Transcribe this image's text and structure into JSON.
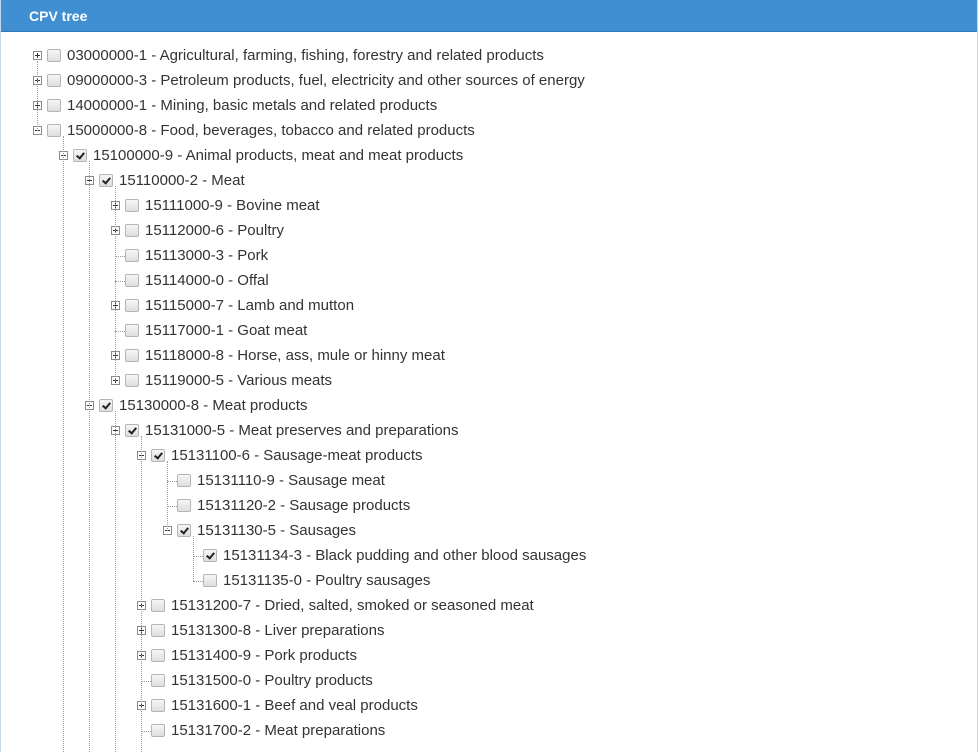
{
  "panel": {
    "title": "CPV tree"
  },
  "tree": [
    {
      "depth": 0,
      "toggle": "plus",
      "checked": false,
      "label": "03000000-1 - Agricultural, farming, fishing, forestry and related products"
    },
    {
      "depth": 0,
      "toggle": "plus",
      "checked": false,
      "label": "09000000-3 - Petroleum products, fuel, electricity and other sources of energy"
    },
    {
      "depth": 0,
      "toggle": "plus",
      "checked": false,
      "label": "14000000-1 - Mining, basic metals and related products"
    },
    {
      "depth": 0,
      "toggle": "minus",
      "checked": false,
      "label": "15000000-8 - Food, beverages, tobacco and related products"
    },
    {
      "depth": 1,
      "toggle": "minus",
      "checked": true,
      "label": "15100000-9 - Animal products, meat and meat products"
    },
    {
      "depth": 2,
      "toggle": "minus",
      "checked": true,
      "label": "15110000-2 - Meat"
    },
    {
      "depth": 3,
      "toggle": "plus",
      "checked": false,
      "label": "15111000-9 - Bovine meat"
    },
    {
      "depth": 3,
      "toggle": "plus",
      "checked": false,
      "label": "15112000-6 - Poultry"
    },
    {
      "depth": 3,
      "toggle": "none",
      "checked": false,
      "label": "15113000-3 - Pork"
    },
    {
      "depth": 3,
      "toggle": "none",
      "checked": false,
      "label": "15114000-0 - Offal"
    },
    {
      "depth": 3,
      "toggle": "plus",
      "checked": false,
      "label": "15115000-7 - Lamb and mutton"
    },
    {
      "depth": 3,
      "toggle": "none",
      "checked": false,
      "label": "15117000-1 - Goat meat"
    },
    {
      "depth": 3,
      "toggle": "plus",
      "checked": false,
      "label": "15118000-8 - Horse, ass, mule or hinny meat"
    },
    {
      "depth": 3,
      "toggle": "plus",
      "checked": false,
      "label": "15119000-5 - Various meats"
    },
    {
      "depth": 2,
      "toggle": "minus",
      "checked": true,
      "label": "15130000-8 - Meat products"
    },
    {
      "depth": 3,
      "toggle": "minus",
      "checked": true,
      "label": "15131000-5 - Meat preserves and preparations"
    },
    {
      "depth": 4,
      "toggle": "minus",
      "checked": true,
      "label": "15131100-6 - Sausage-meat products"
    },
    {
      "depth": 5,
      "toggle": "none",
      "checked": false,
      "label": "15131110-9 - Sausage meat"
    },
    {
      "depth": 5,
      "toggle": "none",
      "checked": false,
      "label": "15131120-2 - Sausage products"
    },
    {
      "depth": 5,
      "toggle": "minus",
      "checked": true,
      "label": "15131130-5 - Sausages"
    },
    {
      "depth": 6,
      "toggle": "none",
      "checked": true,
      "label": "15131134-3 - Black pudding and other blood sausages"
    },
    {
      "depth": 6,
      "toggle": "none",
      "checked": false,
      "label": "15131135-0 - Poultry sausages"
    },
    {
      "depth": 4,
      "toggle": "plus",
      "checked": false,
      "label": "15131200-7 - Dried, salted, smoked or seasoned meat"
    },
    {
      "depth": 4,
      "toggle": "plus",
      "checked": false,
      "label": "15131300-8 - Liver preparations"
    },
    {
      "depth": 4,
      "toggle": "plus",
      "checked": false,
      "label": "15131400-9 - Pork products"
    },
    {
      "depth": 4,
      "toggle": "none",
      "checked": false,
      "label": "15131500-0 - Poultry products"
    },
    {
      "depth": 4,
      "toggle": "plus",
      "checked": false,
      "label": "15131600-1 - Beef and veal products"
    },
    {
      "depth": 4,
      "toggle": "none",
      "checked": false,
      "label": "15131700-2 - Meat preparations"
    }
  ]
}
